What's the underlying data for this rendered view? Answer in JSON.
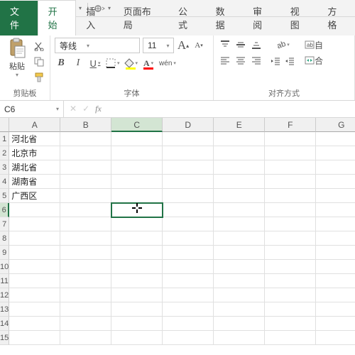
{
  "qat": {
    "save": "save",
    "undo": "undo",
    "redo": "redo"
  },
  "tabs": {
    "file": "文件",
    "home": "开始",
    "insert": "插入",
    "layout": "页面布局",
    "formula": "公式",
    "data": "数据",
    "review": "审阅",
    "view": "视图",
    "extra": "方格"
  },
  "ribbon": {
    "clipboard": {
      "title": "剪贴板",
      "paste": "粘贴"
    },
    "font": {
      "title": "字体",
      "name": "等线",
      "size": "11",
      "bold": "B",
      "italic": "I",
      "underline": "U",
      "wen": "wén",
      "fill_color": "#ffff00",
      "font_color": "#ff0000"
    },
    "align": {
      "title": "对齐方式",
      "wrap": "自",
      "merge": "合"
    }
  },
  "namebox": {
    "ref": "C6",
    "fx": "fx"
  },
  "columns": [
    "A",
    "B",
    "C",
    "D",
    "E",
    "F",
    "G"
  ],
  "cells": {
    "A1": "河北省",
    "A2": "北京市",
    "A3": "湖北省",
    "A4": "湖南省",
    "A5": "广西区"
  },
  "active_cell": "C6",
  "row_count": 15
}
